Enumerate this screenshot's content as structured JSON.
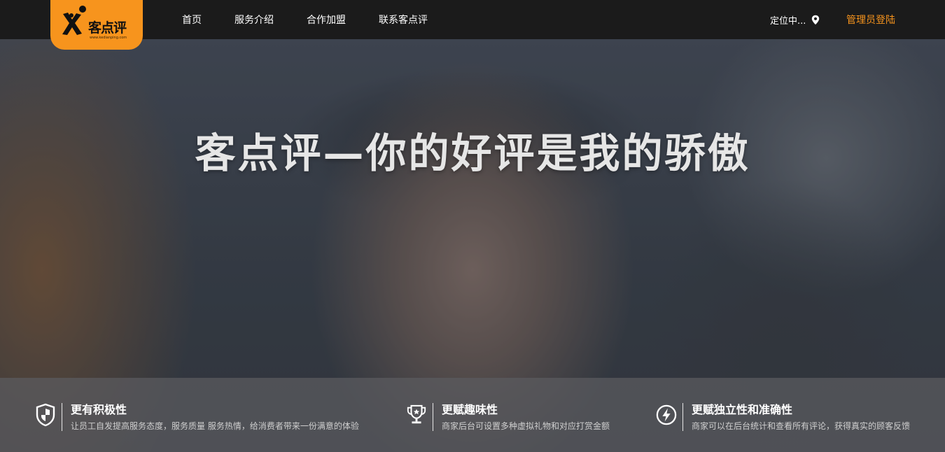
{
  "brand": {
    "name": "客点评",
    "url": "www.kedianping.com",
    "accent_color": "#f7941d"
  },
  "nav": {
    "items": [
      {
        "label": "首页"
      },
      {
        "label": "服务介绍"
      },
      {
        "label": "合作加盟"
      },
      {
        "label": "联系客点评"
      }
    ],
    "location_label": "定位中...",
    "location_icon": "map-pin-icon",
    "admin_login_label": "管理员登陆"
  },
  "hero": {
    "title": "客点评—你的好评是我的骄傲"
  },
  "features": [
    {
      "icon": "shield-icon",
      "title": "更有积极性",
      "desc": "让员工自发提高服务态度，服务质量 服务热情，给消费者带来一份满意的体验"
    },
    {
      "icon": "trophy-icon",
      "title": "更赋趣味性",
      "desc": "商家后台可设置多种虚拟礼物和对应打赏金额"
    },
    {
      "icon": "lightning-icon",
      "title": "更赋独立性和准确性",
      "desc": "商家可以在后台统计和查看所有评论，获得真实的顾客反馈"
    }
  ]
}
